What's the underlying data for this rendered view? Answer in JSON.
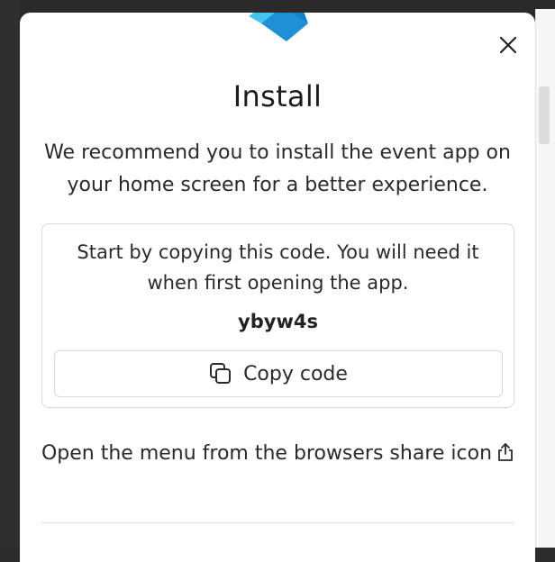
{
  "dialog": {
    "title": "Install",
    "intro": "We recommend you to install the event app on your home screen for a better experience.",
    "code_section": {
      "instructions": "Start by copying this code. You will need it when first opening the app.",
      "code": "ybyw4s",
      "copy_button_label": "Copy code",
      "copy_icon": "copy-icon"
    },
    "share_instructions": "Open the menu from the browsers share icon",
    "share_icon": "share-icon",
    "close_icon": "close-icon"
  },
  "colors": {
    "modal_background": "#ffffff",
    "backdrop": "#2a2a2a",
    "logo_primary": "#1f8fd6",
    "logo_secondary": "#45c4f0",
    "border": "#d9d9d9"
  }
}
